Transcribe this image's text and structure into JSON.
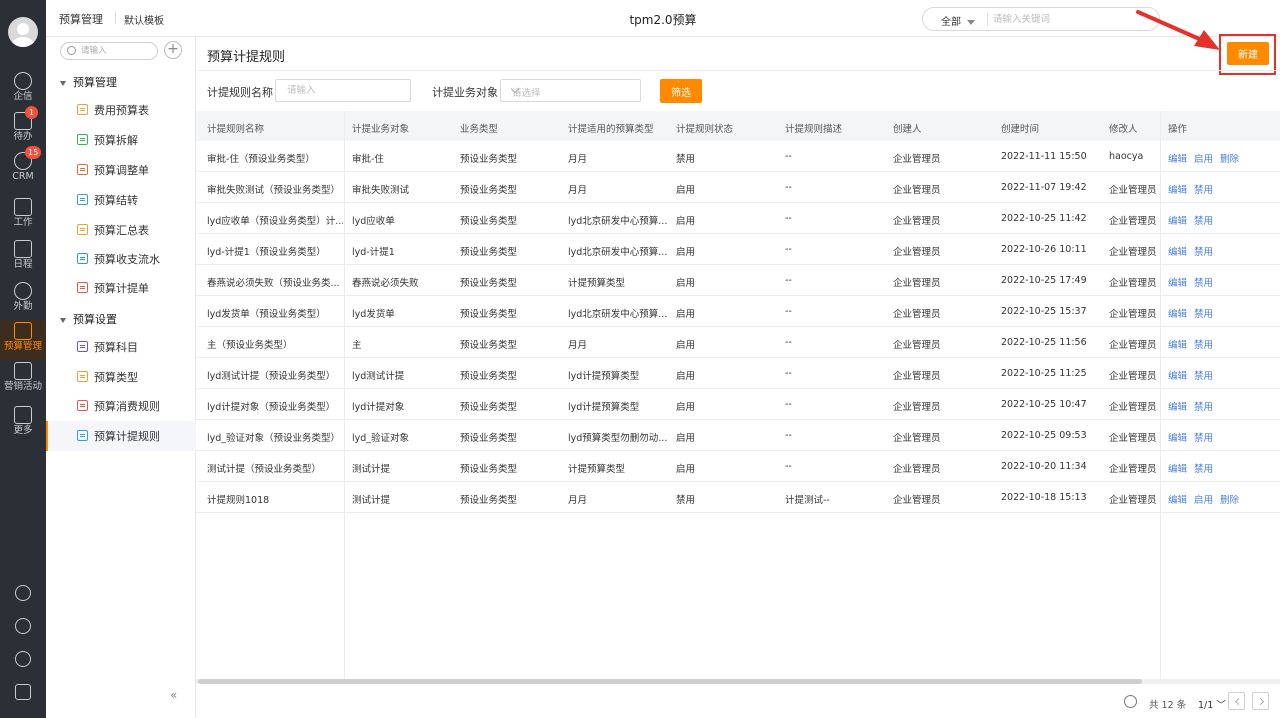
{
  "rail": {
    "items": [
      {
        "label": "企信",
        "badge": ""
      },
      {
        "label": "待办",
        "badge": "1"
      },
      {
        "label": "CRM",
        "badge": "15"
      },
      {
        "label": "工作",
        "badge": ""
      },
      {
        "label": "日程",
        "badge": ""
      },
      {
        "label": "外勤",
        "badge": ""
      },
      {
        "label": "预算管理",
        "badge": ""
      },
      {
        "label": "营销活动",
        "badge": ""
      },
      {
        "label": "更多",
        "badge": ""
      }
    ],
    "active_label": "预算管理"
  },
  "topbar": {
    "crumb_module": "预算管理",
    "crumb_template": "默认模板",
    "app_title": "tpm2.0预算",
    "search_scope": "全部",
    "search_placeholder": "请输入关键词"
  },
  "new_button_label": "新建",
  "subnav": {
    "search_placeholder": "请输入",
    "add_symbol": "+",
    "group1": "预算管理",
    "group2": "预算设置",
    "items": [
      {
        "label": "费用预算表",
        "color": "#e8a23c"
      },
      {
        "label": "预算拆解",
        "color": "#3fae5a"
      },
      {
        "label": "预算调整单",
        "color": "#e06c3c"
      },
      {
        "label": "预算结转",
        "color": "#3a9fd8"
      },
      {
        "label": "预算汇总表",
        "color": "#e8a23c"
      },
      {
        "label": "预算收支流水",
        "color": "#2ba3a3"
      },
      {
        "label": "预算计提单",
        "color": "#e05a4b"
      },
      {
        "label": "预算科目",
        "color": "#6a5acd"
      },
      {
        "label": "预算类型",
        "color": "#e8a23c"
      },
      {
        "label": "预算消费规则",
        "color": "#e05a4b"
      },
      {
        "label": "预算计提规则",
        "color": "#3a9fd8"
      }
    ],
    "collapse_symbol": "«"
  },
  "main": {
    "page_title": "预算计提规则",
    "filter": {
      "name_label": "计提规则名称",
      "name_placeholder": "请输入",
      "object_label": "计提业务对象",
      "object_placeholder": "请选择",
      "button": "筛选"
    },
    "columns": [
      "计提规则名称",
      "计提业务对象",
      "业务类型",
      "计提适用的预算类型",
      "计提规则状态",
      "计提规则描述",
      "创建人",
      "创建时间",
      "修改人",
      "操作"
    ],
    "rows": [
      {
        "name": "审批-住（预设业务类型）",
        "object": "审批-住",
        "btype": "预设业务类型",
        "budget": "月月",
        "status": "禁用",
        "desc": "--",
        "creator": "企业管理员",
        "ctime": "2022-11-11 15:50",
        "modifier": "haocya",
        "actions": [
          "编辑",
          "启用",
          "删除"
        ]
      },
      {
        "name": "审批失败测试（预设业务类型）",
        "object": "审批失败测试",
        "btype": "预设业务类型",
        "budget": "月月",
        "status": "启用",
        "desc": "--",
        "creator": "企业管理员",
        "ctime": "2022-11-07 19:42",
        "modifier": "企业管理员",
        "actions": [
          "编辑",
          "禁用"
        ]
      },
      {
        "name": "lyd应收单（预设业务类型）计...",
        "object": "lyd应收单",
        "btype": "预设业务类型",
        "budget": "lyd北京研发中心预算...",
        "status": "启用",
        "desc": "--",
        "creator": "企业管理员",
        "ctime": "2022-10-25 11:42",
        "modifier": "企业管理员",
        "actions": [
          "编辑",
          "禁用"
        ]
      },
      {
        "name": "lyd-计提1（预设业务类型）",
        "object": "lyd-计提1",
        "btype": "预设业务类型",
        "budget": "lyd北京研发中心预算...",
        "status": "启用",
        "desc": "--",
        "creator": "企业管理员",
        "ctime": "2022-10-26 10:11",
        "modifier": "企业管理员",
        "actions": [
          "编辑",
          "禁用"
        ]
      },
      {
        "name": "春燕说必须失败（预设业务类...",
        "object": "春燕说必须失败",
        "btype": "预设业务类型",
        "budget": "计提预算类型",
        "status": "启用",
        "desc": "--",
        "creator": "企业管理员",
        "ctime": "2022-10-25 17:49",
        "modifier": "企业管理员",
        "actions": [
          "编辑",
          "禁用"
        ]
      },
      {
        "name": "lyd发货单（预设业务类型）",
        "object": "lyd发货单",
        "btype": "预设业务类型",
        "budget": "lyd北京研发中心预算...",
        "status": "启用",
        "desc": "--",
        "creator": "企业管理员",
        "ctime": "2022-10-25 15:37",
        "modifier": "企业管理员",
        "actions": [
          "编辑",
          "禁用"
        ]
      },
      {
        "name": "主（预设业务类型）",
        "object": "主",
        "btype": "预设业务类型",
        "budget": "月月",
        "status": "启用",
        "desc": "--",
        "creator": "企业管理员",
        "ctime": "2022-10-25 11:56",
        "modifier": "企业管理员",
        "actions": [
          "编辑",
          "禁用"
        ]
      },
      {
        "name": "lyd测试计提（预设业务类型）",
        "object": "lyd测试计提",
        "btype": "预设业务类型",
        "budget": "lyd计提预算类型",
        "status": "启用",
        "desc": "--",
        "creator": "企业管理员",
        "ctime": "2022-10-25 11:25",
        "modifier": "企业管理员",
        "actions": [
          "编辑",
          "禁用"
        ]
      },
      {
        "name": "lyd计提对象（预设业务类型）",
        "object": "lyd计提对象",
        "btype": "预设业务类型",
        "budget": "lyd计提预算类型",
        "status": "启用",
        "desc": "--",
        "creator": "企业管理员",
        "ctime": "2022-10-25 10:47",
        "modifier": "企业管理员",
        "actions": [
          "编辑",
          "禁用"
        ]
      },
      {
        "name": "lyd_验证对象（预设业务类型）",
        "object": "lyd_验证对象",
        "btype": "预设业务类型",
        "budget": "lyd预算类型勿删勿动...",
        "status": "启用",
        "desc": "--",
        "creator": "企业管理员",
        "ctime": "2022-10-25 09:53",
        "modifier": "企业管理员",
        "actions": [
          "编辑",
          "禁用"
        ]
      },
      {
        "name": "测试计提（预设业务类型）",
        "object": "测试计提",
        "btype": "预设业务类型",
        "budget": "计提预算类型",
        "status": "启用",
        "desc": "--",
        "creator": "企业管理员",
        "ctime": "2022-10-20 11:34",
        "modifier": "企业管理员",
        "actions": [
          "编辑",
          "禁用"
        ]
      },
      {
        "name": "计提规则1018",
        "object": "测试计提",
        "btype": "预设业务类型",
        "budget": "月月",
        "status": "禁用",
        "desc": "计提测试--",
        "creator": "企业管理员",
        "ctime": "2022-10-18 15:13",
        "modifier": "企业管理员",
        "actions": [
          "编辑",
          "启用",
          "删除"
        ]
      }
    ]
  },
  "footer": {
    "total": "共 12 条",
    "page": "1/1"
  },
  "colors": {
    "accent": "#ff8a00",
    "link": "#4a7fdc",
    "highlight": "#e4322b",
    "rail": "#2b2f36"
  }
}
